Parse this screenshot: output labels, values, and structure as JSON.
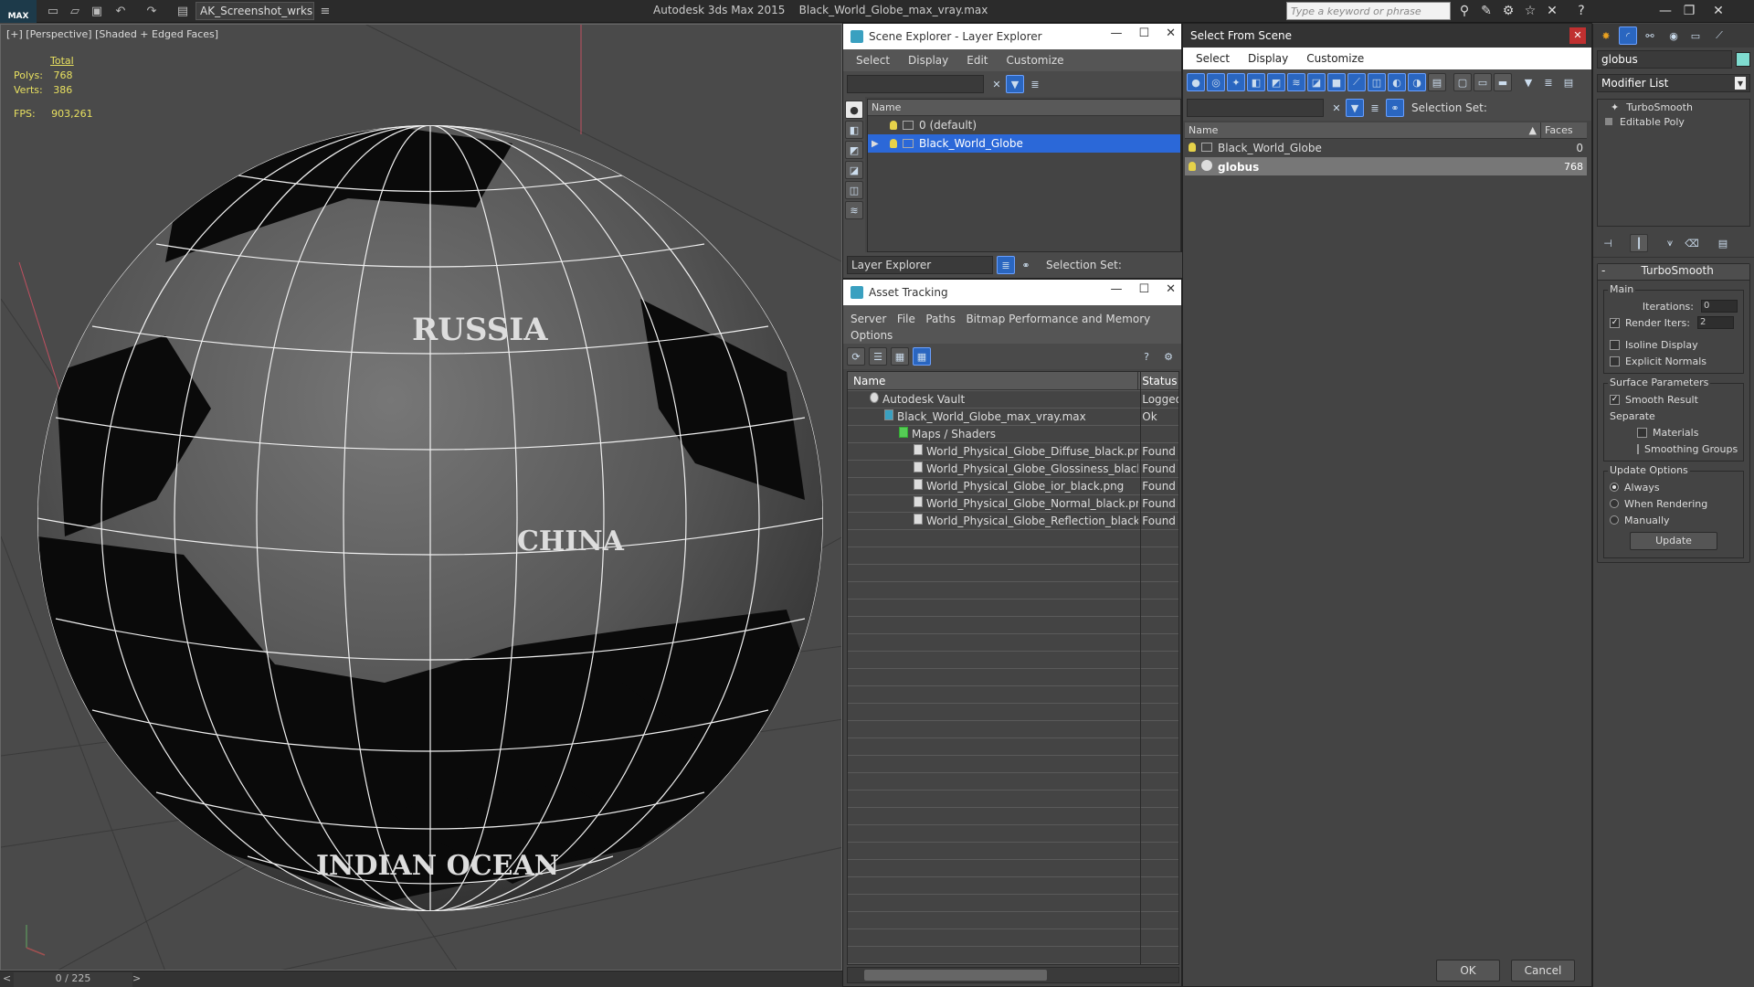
{
  "titlebar": {
    "logo": "MAX",
    "workspace": "AK_Screenshot_wrksp",
    "app": "Autodesk 3ds Max  2015",
    "file": "Black_World_Globe_max_vray.max",
    "search_placeholder": "Type a keyword or phrase"
  },
  "viewport": {
    "label": "[+] [Perspective] [Shaded + Edged Faces]",
    "stats_header": "Total",
    "polys_label": "Polys:",
    "polys": "768",
    "verts_label": "Verts:",
    "verts": "386",
    "fps_label": "FPS:",
    "fps": "903,261",
    "globe_labels": [
      "RUSSIA",
      "CHINA",
      "INDIAN OCEAN"
    ]
  },
  "timeline": {
    "slider": "0 / 225",
    "next": ">",
    "prev": "<"
  },
  "scene_explorer": {
    "title": "Scene Explorer - Layer Explorer",
    "menu": [
      "Select",
      "Display",
      "Edit",
      "Customize"
    ],
    "col_name": "Name",
    "layers": [
      "0 (default)",
      "Black_World_Globe"
    ],
    "footer_dropdown": "Layer Explorer",
    "selection_set": "Selection Set:"
  },
  "asset_tracking": {
    "title": "Asset Tracking",
    "menu": [
      "Server",
      "File",
      "Paths",
      "Bitmap Performance and Memory"
    ],
    "menu2": "Options",
    "col_name": "Name",
    "col_status": "Status",
    "rows": [
      {
        "name": "Autodesk Vault",
        "status": "Logged"
      },
      {
        "name": "Black_World_Globe_max_vray.max",
        "status": "Ok"
      },
      {
        "name": "Maps / Shaders",
        "status": ""
      },
      {
        "name": "World_Physical_Globe_Diffuse_black.png",
        "status": "Found"
      },
      {
        "name": "World_Physical_Globe_Glossiness_black.p...",
        "status": "Found"
      },
      {
        "name": "World_Physical_Globe_ior_black.png",
        "status": "Found"
      },
      {
        "name": "World_Physical_Globe_Normal_black.png",
        "status": "Found"
      },
      {
        "name": "World_Physical_Globe_Reflection_black.png",
        "status": "Found"
      }
    ]
  },
  "select_from_scene": {
    "title": "Select From Scene",
    "menu": [
      "Select",
      "Display",
      "Customize"
    ],
    "selection_set": "Selection Set:",
    "col_name": "Name",
    "col_faces": "Faces",
    "rows": [
      {
        "name": "Black_World_Globe",
        "faces": "0"
      },
      {
        "name": "globus",
        "faces": "768"
      }
    ],
    "ok": "OK",
    "cancel": "Cancel"
  },
  "command_panel": {
    "object_name": "globus",
    "modifier_list": "Modifier List",
    "stack": [
      "TurboSmooth",
      "Editable Poly"
    ],
    "rollout_title": "TurboSmooth",
    "main_group": "Main",
    "iterations_label": "Iterations:",
    "iterations": "0",
    "render_iters_label": "Render Iters:",
    "render_iters": "2",
    "isoline": "Isoline Display",
    "explicit": "Explicit Normals",
    "surface_group": "Surface Parameters",
    "smooth_result": "Smooth Result",
    "separate": "Separate",
    "materials": "Materials",
    "smoothing_groups": "Smoothing Groups",
    "update_group": "Update Options",
    "always": "Always",
    "when_rendering": "When Rendering",
    "manually": "Manually",
    "update_btn": "Update"
  },
  "colors": {
    "selection": "#2b68d8",
    "accent": "#e8e060"
  }
}
